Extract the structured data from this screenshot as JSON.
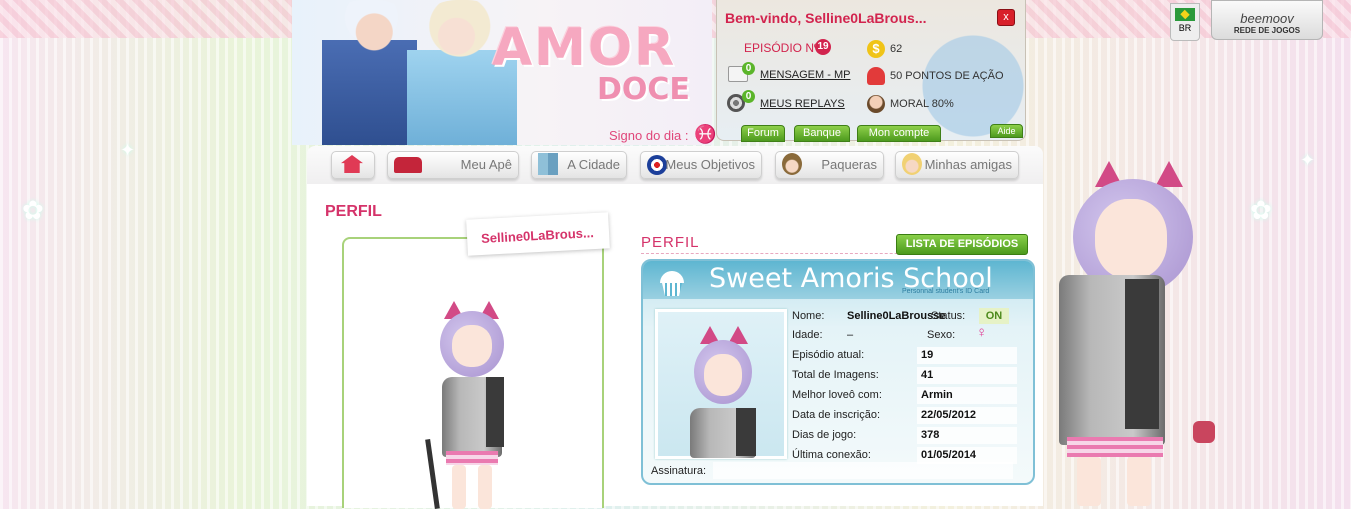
{
  "header": {
    "logo": {
      "line1": "AMOR",
      "line2": "DOCE"
    },
    "signo_label": "Signo do dia :",
    "signo_icon": "pisces-icon"
  },
  "user_panel": {
    "welcome": "Bem-vindo, Selline0LaBrous...",
    "close_label": "x",
    "episode_label": "EPISÓDIO Nº",
    "episode_number": "19",
    "messages_count": "0",
    "messages_label": "MENSAGEM - MP",
    "replays_count": "0",
    "replays_label": "MEUS REPLAYS",
    "money": "62",
    "action_points": "50 PONTOS DE AÇÃO",
    "moral": "MORAL 80%",
    "buttons": [
      "Forum",
      "Banque",
      "Mon compte",
      "Aide"
    ]
  },
  "topright": {
    "flag_label": "BR",
    "network_logo": "beemoov",
    "network_label": "REDE DE JOGOS"
  },
  "nav": [
    {
      "label": "",
      "icon": "home-icon"
    },
    {
      "label": "Meu Apê",
      "icon": "sofa-icon"
    },
    {
      "label": "A Cidade",
      "icon": "city-icon"
    },
    {
      "label": "Meus Objetivos",
      "icon": "target-icon"
    },
    {
      "label": "Paqueras",
      "icon": "boy-icon"
    },
    {
      "label": "Minhas amigas",
      "icon": "girl-icon"
    }
  ],
  "page": {
    "title": "PERFIL",
    "username_tag": "Selline0LaBrous...",
    "section_title": "PERFIL",
    "list_button": "LISTA DE EPISÓDIOS"
  },
  "id_card": {
    "school": "Sweet Amoris School",
    "subtitle": "Personnal student's ID Card",
    "name_label": "Nome:",
    "name_value": "Selline0LaBrousse",
    "status_label": "Status:",
    "status_value": "ON",
    "age_label": "Idade:",
    "age_value": "–",
    "sex_label": "Sexo:",
    "sex_icon": "female-symbol-icon",
    "rows": [
      {
        "label": "Episódio atual:",
        "value": "19"
      },
      {
        "label": "Total de Imagens:",
        "value": "41"
      },
      {
        "label": "Melhor loveô com:",
        "value": "Armin"
      },
      {
        "label": "Data de inscrição:",
        "value": "22/05/2012"
      },
      {
        "label": "Dias de jogo:",
        "value": "378"
      },
      {
        "label": "Última conexão:",
        "value": "01/05/2014"
      }
    ],
    "signature_label": "Assinatura:"
  },
  "colors": {
    "accent_pink": "#d5336a",
    "button_green": "#5bb52a",
    "card_blue": "#5eb6d1"
  }
}
